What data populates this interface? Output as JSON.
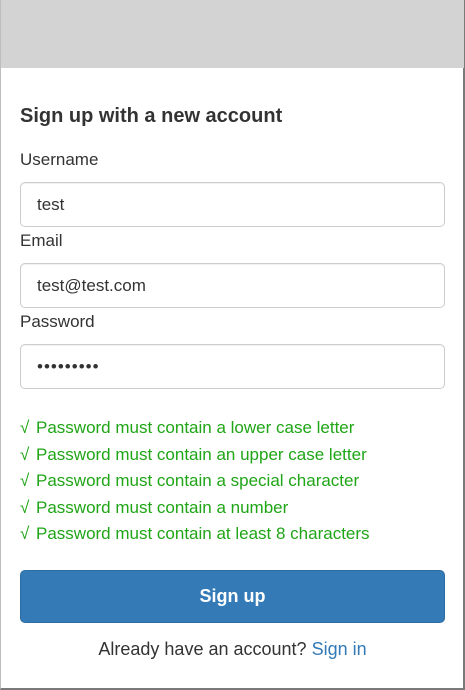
{
  "form": {
    "heading": "Sign up with a new account",
    "username": {
      "label": "Username",
      "value": "test"
    },
    "email": {
      "label": "Email",
      "value": "test@test.com"
    },
    "password": {
      "label": "Password",
      "value": "•••••••••"
    },
    "requirements": [
      {
        "icon": "check-icon",
        "mark": "√",
        "text": "Password must contain a lower case letter"
      },
      {
        "icon": "check-icon",
        "mark": "√",
        "text": "Password must contain an upper case letter"
      },
      {
        "icon": "check-icon",
        "mark": "√",
        "text": "Password must contain a special character"
      },
      {
        "icon": "check-icon",
        "mark": "√",
        "text": "Password must contain a number"
      },
      {
        "icon": "check-icon",
        "mark": "√",
        "text": "Password must contain at least 8 characters"
      }
    ],
    "submit_label": "Sign up",
    "footer": {
      "prompt": "Already have an account?",
      "link_label": "Sign in"
    }
  },
  "colors": {
    "header_bar": "#d3d3d3",
    "success_green": "#1fa516",
    "primary_blue": "#337ab7"
  }
}
